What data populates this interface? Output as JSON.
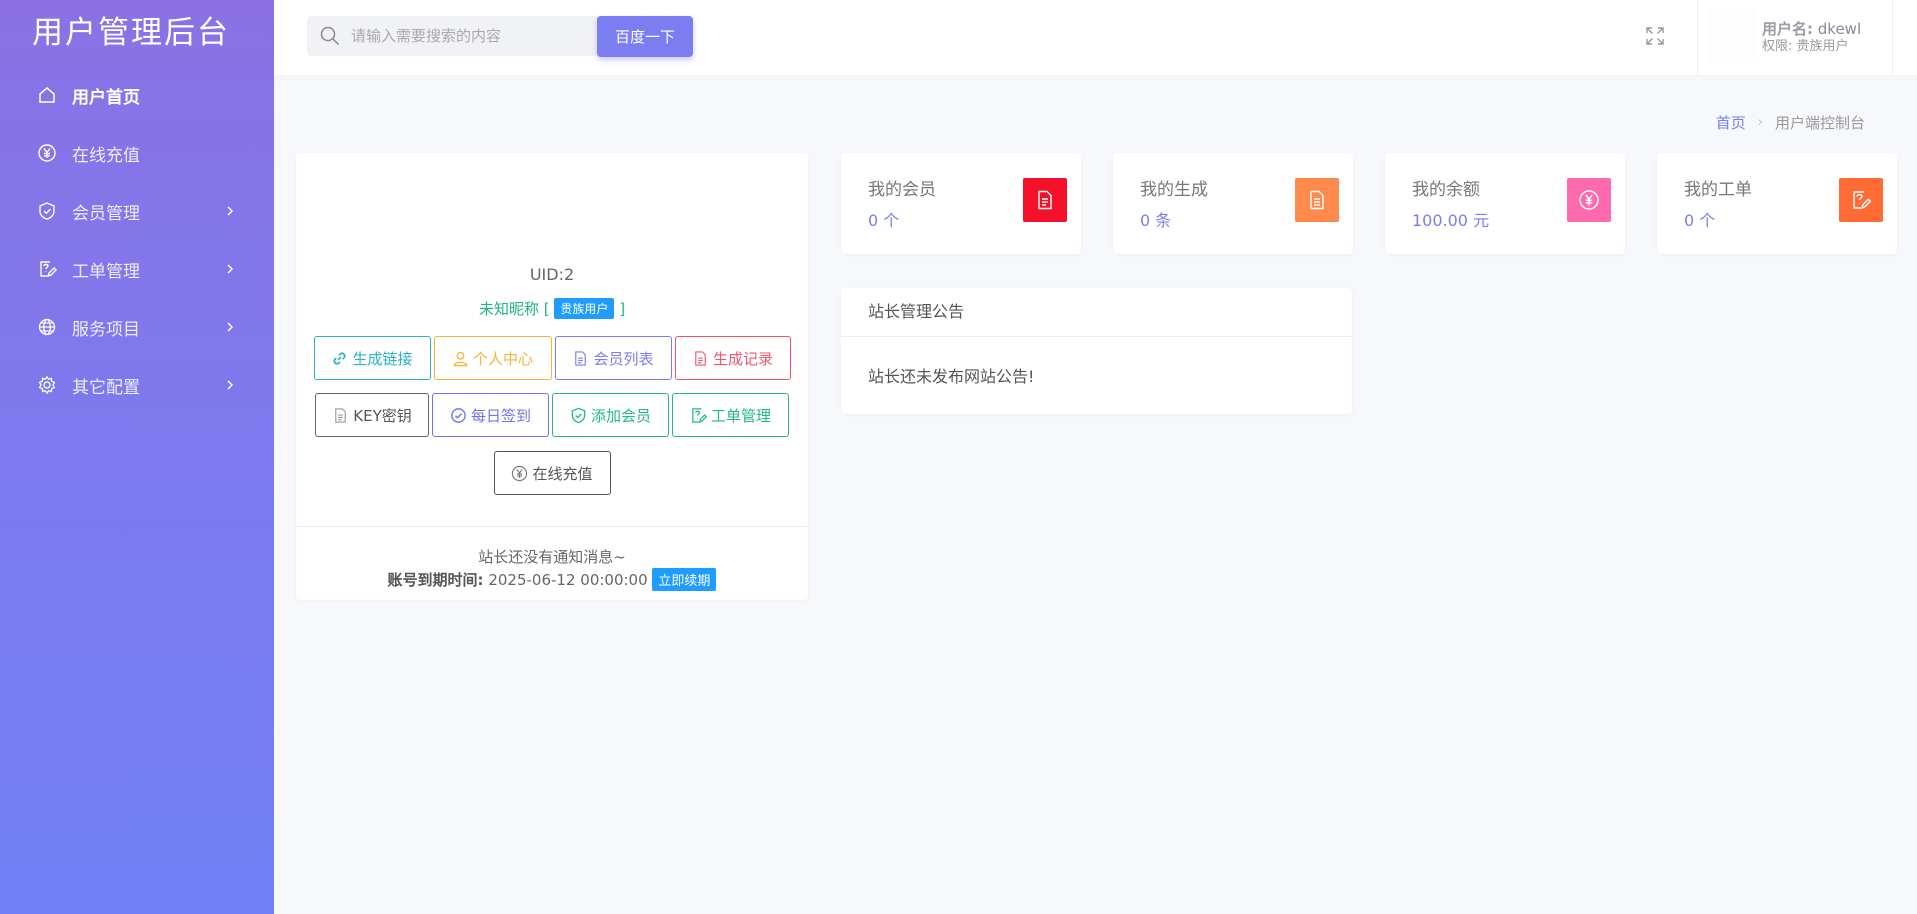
{
  "sidebar": {
    "brand": "用户管理后台",
    "items": [
      {
        "label": "用户首页",
        "icon": "home-icon",
        "active": true,
        "has_children": false
      },
      {
        "label": "在线充值",
        "icon": "yen-icon",
        "active": false,
        "has_children": false
      },
      {
        "label": "会员管理",
        "icon": "shield-icon",
        "active": false,
        "has_children": true
      },
      {
        "label": "工单管理",
        "icon": "ticket-edit-icon",
        "active": false,
        "has_children": true
      },
      {
        "label": "服务项目",
        "icon": "globe-icon",
        "active": false,
        "has_children": true
      },
      {
        "label": "其它配置",
        "icon": "gear-icon",
        "active": false,
        "has_children": true
      }
    ]
  },
  "header": {
    "search_placeholder": "请输入需要搜索的内容",
    "search_button": "百度一下",
    "user_name_label": "用户名:",
    "user_name": "dkewl",
    "permission": "权限: 贵族用户"
  },
  "breadcrumb": {
    "home": "首页",
    "current": "用户端控制台"
  },
  "profile": {
    "uid": "UID:2",
    "nickname": "未知昵称",
    "bracket_open": "[",
    "bracket_close": "]",
    "vip_badge": "贵族用户",
    "buttons_row1": [
      "生成链接",
      "个人中心",
      "会员列表",
      "生成记录"
    ],
    "buttons_row2": [
      "KEY密钥",
      "每日签到",
      "添加会员",
      "工单管理"
    ],
    "buttons_row3": [
      "在线充值"
    ],
    "notice": "站长还没有通知消息~",
    "expire_label": "账号到期时间:",
    "expire_value": "2025-06-12 00:00:00",
    "renew": "立即续期"
  },
  "stats": [
    {
      "title": "我的会员",
      "value": "0 个",
      "color": "#f5102a",
      "icon": "doc-icon"
    },
    {
      "title": "我的生成",
      "value": "0 条",
      "color": "#ff8a4c",
      "icon": "list-doc-icon"
    },
    {
      "title": "我的余额",
      "value": "100.00 元",
      "color": "#ff69ae",
      "icon": "yen-icon"
    },
    {
      "title": "我的工单",
      "value": "0 个",
      "color": "#ff6b35",
      "icon": "ticket-edit-icon"
    }
  ],
  "announcement": {
    "title": "站长管理公告",
    "body": "站长还未发布网站公告!"
  },
  "colors": {
    "accent": "#7b7df1",
    "sidebar_top": "#8a72e4",
    "sidebar_bottom": "#7080f4"
  }
}
